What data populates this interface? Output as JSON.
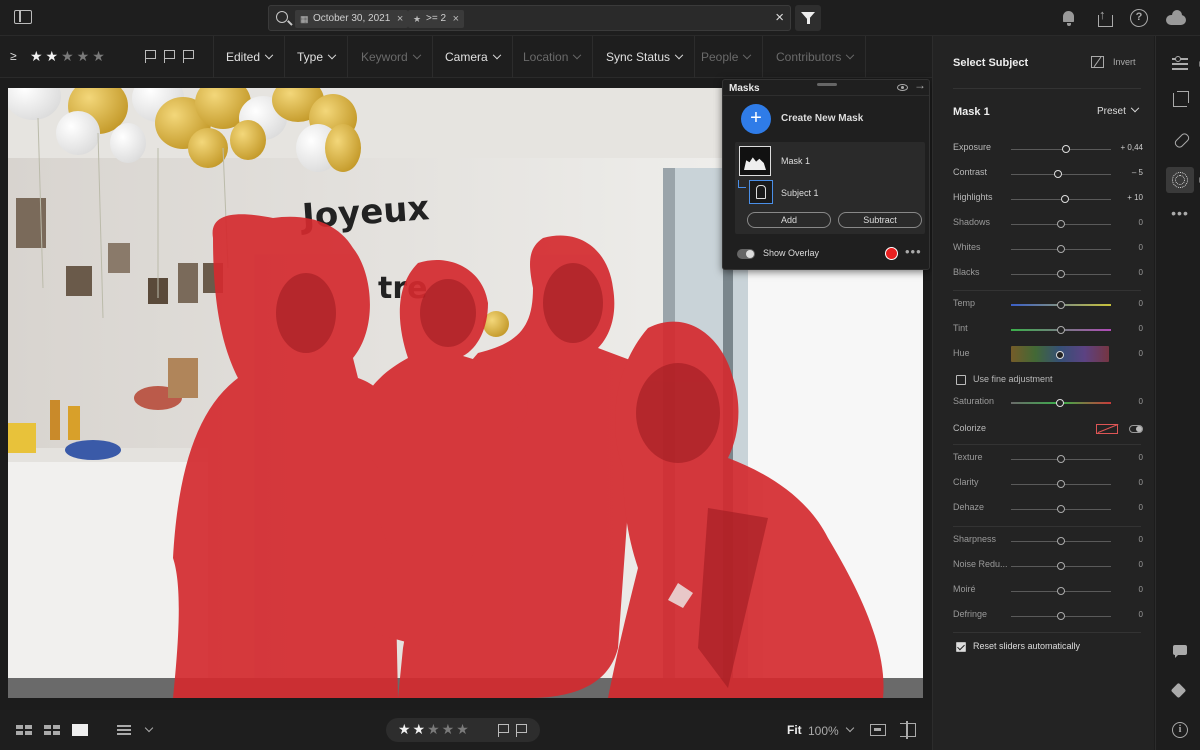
{
  "topbar": {
    "filter_date": "October 30, 2021",
    "filter_rating": ">= 2",
    "icons": [
      "sidebar-toggle-icon",
      "search-icon",
      "calendar-icon",
      "star-icon",
      "close-icon",
      "filter-funnel-icon",
      "bell-icon",
      "share-icon",
      "help-icon",
      "cloud-icon"
    ]
  },
  "filterbar": {
    "rating_operator": "≥",
    "stars_on": "★★",
    "stars_off": "★★★",
    "items": [
      {
        "label": "Edited",
        "enabled": true
      },
      {
        "label": "Type",
        "enabled": true
      },
      {
        "label": "Keyword",
        "enabled": false
      },
      {
        "label": "Camera",
        "enabled": true
      },
      {
        "label": "Location",
        "enabled": false
      },
      {
        "label": "Sync Status",
        "enabled": true
      },
      {
        "label": "People",
        "enabled": false
      },
      {
        "label": "Contributors",
        "enabled": false
      }
    ]
  },
  "masks": {
    "title": "Masks",
    "create_label": "Create New Mask",
    "create_symbol": "+",
    "mask_name": "Mask 1",
    "component_name": "Subject 1",
    "add_label": "Add",
    "subtract_label": "Subtract",
    "overlay_label": "Show Overlay",
    "overlay_enabled": true,
    "overlay_color": "#e82020",
    "more_symbol": "•••",
    "close_symbol": "→"
  },
  "rightpanel": {
    "header": "Select Subject",
    "invert_label": "Invert",
    "mask_title": "Mask 1",
    "preset_label": "Preset",
    "sliders": [
      {
        "label": "Exposure",
        "value": "+ 0,44",
        "pos": 0.55,
        "active": true
      },
      {
        "label": "Contrast",
        "value": "– 5",
        "pos": 0.47,
        "active": true
      },
      {
        "label": "Highlights",
        "value": "+ 10",
        "pos": 0.54,
        "active": true
      },
      {
        "label": "Shadows",
        "value": "0",
        "pos": 0.5,
        "active": false
      },
      {
        "label": "Whites",
        "value": "0",
        "pos": 0.5,
        "active": false
      },
      {
        "label": "Blacks",
        "value": "0",
        "pos": 0.5,
        "active": false
      }
    ],
    "color_sliders": [
      {
        "label": "Temp",
        "value": "0",
        "pos": 0.5
      },
      {
        "label": "Tint",
        "value": "0",
        "pos": 0.5
      }
    ],
    "hue": {
      "label": "Hue",
      "value": "0"
    },
    "fine_adjust_label": "Use fine adjustment",
    "saturation": {
      "label": "Saturation",
      "value": "0"
    },
    "colorize_label": "Colorize",
    "effects": [
      {
        "label": "Texture",
        "value": "0"
      },
      {
        "label": "Clarity",
        "value": "0"
      },
      {
        "label": "Dehaze",
        "value": "0"
      }
    ],
    "detail": [
      {
        "label": "Sharpness",
        "value": "0"
      },
      {
        "label": "Noise Redu...",
        "value": "0"
      },
      {
        "label": "Moiré",
        "value": "0"
      },
      {
        "label": "Defringe",
        "value": "0"
      }
    ],
    "reset_label": "Reset sliders automatically",
    "reset_checked": true
  },
  "rail": {
    "icons": [
      "edit-sliders-icon",
      "crop-icon",
      "healing-icon",
      "masking-icon",
      "more-icon",
      "comment-icon",
      "tag-icon",
      "info-icon"
    ],
    "more_symbol": "•••",
    "info_symbol": "i"
  },
  "bottombar": {
    "stars_on": "★★",
    "stars_off": "★★★",
    "fit_label": "Fit",
    "zoom_label": "100%"
  }
}
